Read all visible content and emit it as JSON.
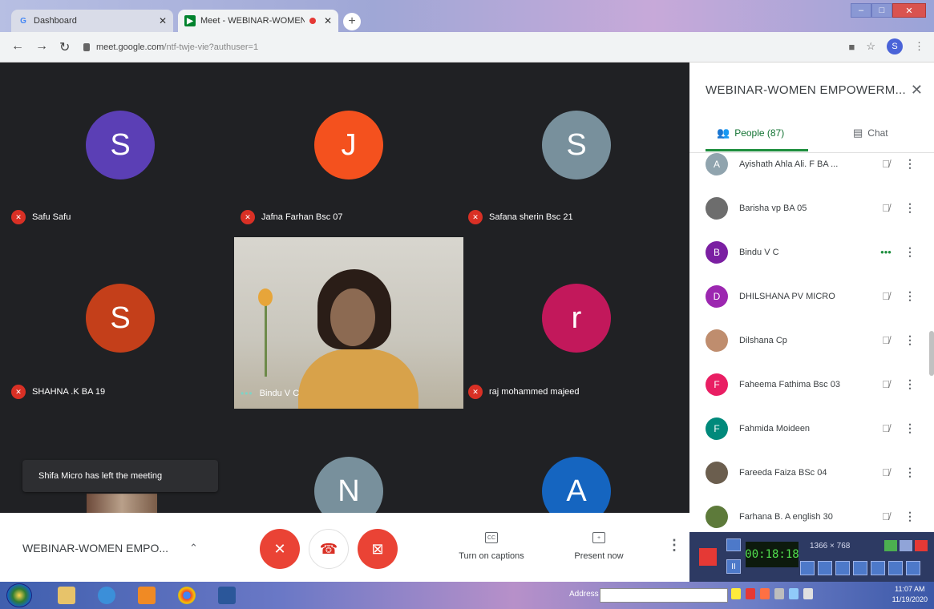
{
  "browser": {
    "tabs": [
      {
        "title": "Dashboard",
        "favicon": "G",
        "active": false
      },
      {
        "title": "Meet - WEBINAR-WOMEN E",
        "favicon": "meet-icon",
        "active": true
      }
    ],
    "new_tab": "+",
    "url_host": "meet.google.com",
    "url_path": "/ntf-twje-vie?authuser=1",
    "profile_initial": "S"
  },
  "grid": {
    "tiles": [
      {
        "initial": "S",
        "name": "Safu Safu",
        "color": "#5b3fb5"
      },
      {
        "initial": "J",
        "name": "Jafna Farhan Bsc 07",
        "color": "#f4511e"
      },
      {
        "initial": "S",
        "name": "Safana sherin Bsc 21",
        "color": "#78909c"
      },
      {
        "initial": "S",
        "name": "SHAHNA .K BA 19",
        "color": "#c43f1a"
      },
      {
        "initial": "r",
        "name": "raj mohammed majeed",
        "color": "#c2185b"
      },
      {
        "initial": "N",
        "name": "",
        "color": "#78909c"
      },
      {
        "initial": "A",
        "name": "",
        "color": "#1565c0"
      }
    ],
    "video_tile_name": "Bindu V C",
    "toast": "Shifa Micro has left the meeting"
  },
  "panel": {
    "title": "WEBINAR-WOMEN EMPOWERM...",
    "tab_people": "People (87)",
    "tab_chat": "Chat",
    "participants": [
      {
        "initial": "A",
        "name": "Ayishath Ahla Ali. F BA ...",
        "color": "#90a4ae",
        "status": "muted"
      },
      {
        "initial": "",
        "name": "Barisha vp BA 05",
        "color": "#6d6d6d",
        "status": "muted"
      },
      {
        "initial": "B",
        "name": "Bindu V C",
        "color": "#7b1fa2",
        "status": "speaking"
      },
      {
        "initial": "D",
        "name": "DHILSHANA PV MICRO",
        "color": "#9c27b0",
        "status": "muted"
      },
      {
        "initial": "",
        "name": "Dilshana Cp",
        "color": "#bf8d6e",
        "status": "muted"
      },
      {
        "initial": "F",
        "name": "Faheema Fathima Bsc 03",
        "color": "#e91e63",
        "status": "muted"
      },
      {
        "initial": "F",
        "name": "Fahmida Moideen",
        "color": "#00897b",
        "status": "muted"
      },
      {
        "initial": "",
        "name": "Fareeda Faiza BSc 04",
        "color": "#6b5e4e",
        "status": "muted"
      },
      {
        "initial": "",
        "name": "Farhana B. A english 30",
        "color": "#5d7a3a",
        "status": "muted"
      }
    ]
  },
  "bottombar": {
    "meeting_title": "WEBINAR-WOMEN EMPO...",
    "captions_label": "Turn on captions",
    "present_label": "Present now"
  },
  "recorder": {
    "timer": "00:18:18",
    "resolution": "1366 × 768"
  },
  "taskbar": {
    "address_label": "Address",
    "time": "11:07 AM",
    "date": "11/19/2020"
  }
}
